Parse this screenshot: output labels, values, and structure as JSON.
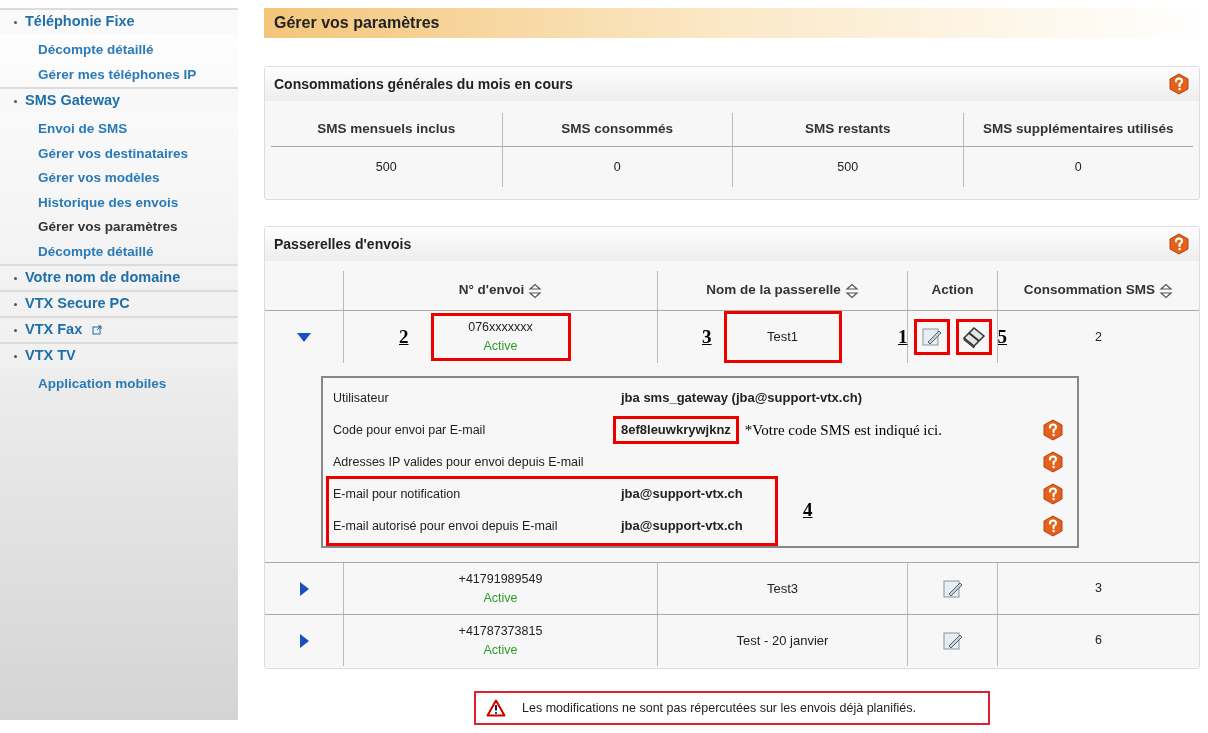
{
  "sidebar": {
    "items": [
      {
        "kind": "section",
        "label": "Téléphonie Fixe",
        "selected": false,
        "external": false
      },
      {
        "kind": "link",
        "label": "Décompte détaillé",
        "selected": false
      },
      {
        "kind": "link",
        "label": "Gérer mes téléphones IP",
        "selected": false
      },
      {
        "kind": "section",
        "label": "SMS Gateway",
        "selected": false,
        "external": false
      },
      {
        "kind": "link",
        "label": "Envoi de SMS",
        "selected": false
      },
      {
        "kind": "link",
        "label": "Gérer vos destinataires",
        "selected": false
      },
      {
        "kind": "link",
        "label": "Gérer vos modèles",
        "selected": false
      },
      {
        "kind": "link",
        "label": "Historique des envois",
        "selected": false
      },
      {
        "kind": "link",
        "label": "Gérer vos paramètres",
        "selected": true
      },
      {
        "kind": "link",
        "label": "Décompte détaillé",
        "selected": false
      },
      {
        "kind": "section",
        "label": "Votre nom de domaine",
        "selected": false,
        "external": false
      },
      {
        "kind": "section",
        "label": "VTX Secure PC",
        "selected": false,
        "external": false
      },
      {
        "kind": "section",
        "label": "VTX Fax",
        "selected": false,
        "external": true
      },
      {
        "kind": "section",
        "label": "VTX TV",
        "selected": false,
        "external": false
      },
      {
        "kind": "link",
        "label": "Application mobiles",
        "selected": false
      }
    ]
  },
  "page_title": "Gérer vos paramètres",
  "usage_panel": {
    "title": "Consommations générales du mois en cours",
    "columns": [
      "SMS mensuels inclus",
      "SMS consommés",
      "SMS restants",
      "SMS supplémentaires utilisés"
    ],
    "values": [
      "500",
      "0",
      "500",
      "0"
    ]
  },
  "gateways_panel": {
    "title": "Passerelles d'envois",
    "columns": [
      {
        "label": "N° d'envoi",
        "sortable": true
      },
      {
        "label": "Nom de la passerelle",
        "sortable": true
      },
      {
        "label": "Action",
        "sortable": false
      },
      {
        "label": "Consommation SMS",
        "sortable": true
      }
    ],
    "rows": [
      {
        "expanded": true,
        "number": "076xxxxxxx",
        "status": "Active",
        "name": "Test1",
        "consumption": "2",
        "number_callout": "2",
        "name_callout": "3",
        "actions": [
          {
            "kind": "edit",
            "callout": "1"
          },
          {
            "kind": "save",
            "callout": "5"
          }
        ],
        "details": {
          "rows": [
            {
              "label": "Utilisateur",
              "value": "jba sms_gateway (jba@support-vtx.ch)",
              "help": false
            },
            {
              "label": "Code pour envoi par E-mail",
              "value": "8ef8leuwkrywjknz",
              "help": true,
              "highlighted": true,
              "note": "*Votre code SMS est indiqué ici."
            },
            {
              "label": "Adresses IP valides pour envoi depuis E-mail",
              "help": true
            }
          ],
          "group": {
            "callout": "4",
            "rows": [
              {
                "label": "E-mail pour notification",
                "value": "jba@support-vtx.ch",
                "help": true
              },
              {
                "label": "E-mail autorisé pour envoi depuis E-mail",
                "value": "jba@support-vtx.ch",
                "help": true
              }
            ]
          }
        }
      },
      {
        "expanded": false,
        "number": "+41791989549",
        "status": "Active",
        "name": "Test3",
        "consumption": "3",
        "actions": [
          {
            "kind": "edit"
          }
        ]
      },
      {
        "expanded": false,
        "number": "+41787373815",
        "status": "Active",
        "name": "Test - 20 janvier",
        "consumption": "6",
        "actions": [
          {
            "kind": "edit"
          }
        ]
      }
    ]
  },
  "warning": "Les modifications ne sont pas répercutées sur les envois déjà planifiés."
}
